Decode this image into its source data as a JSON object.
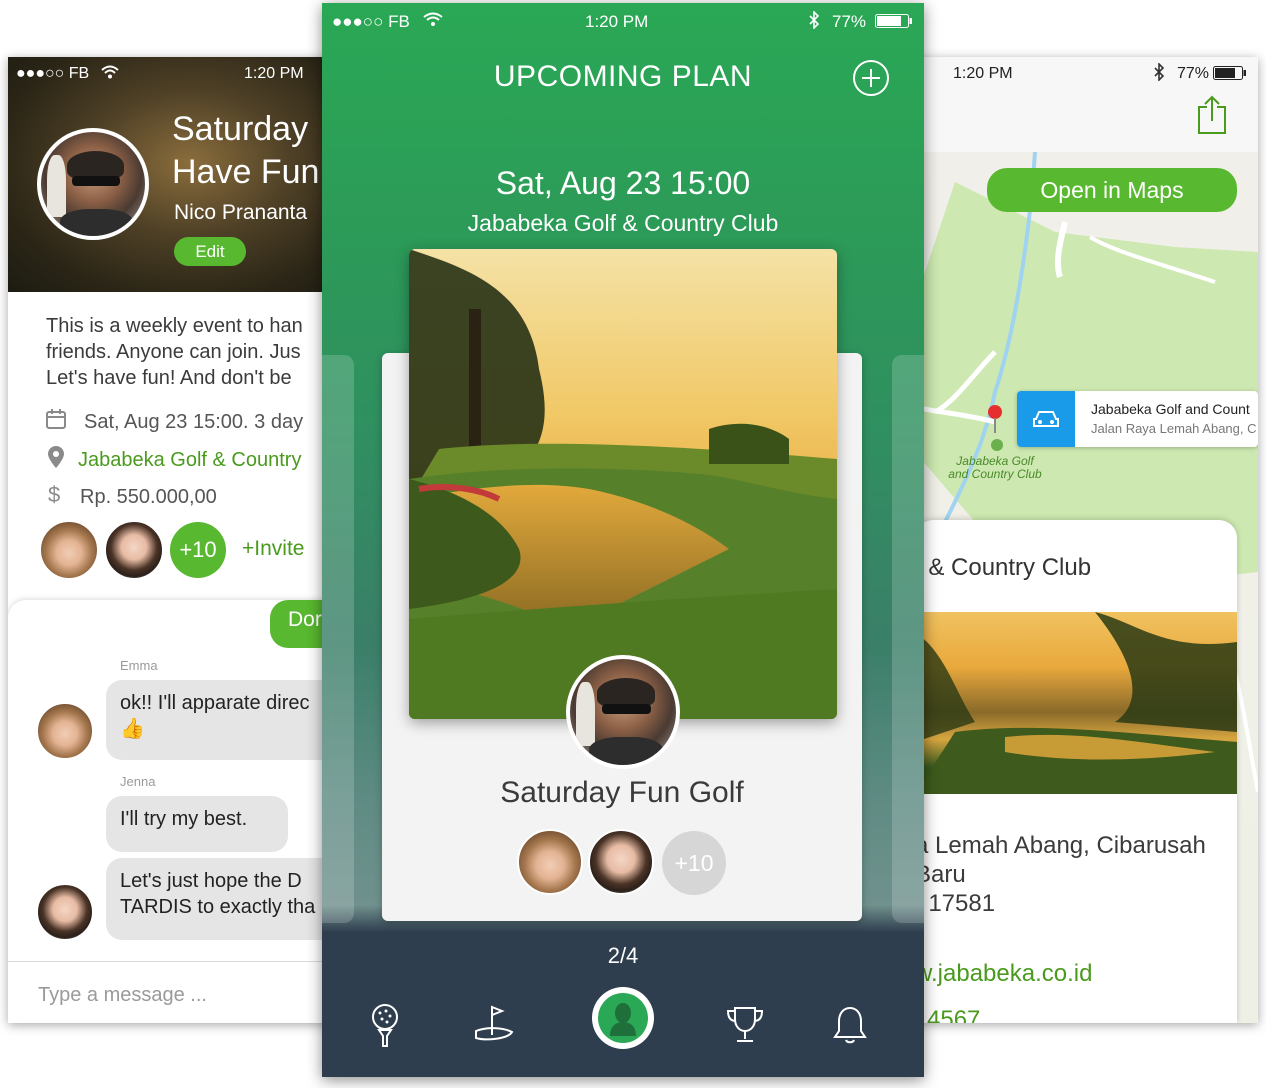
{
  "left_screen": {
    "status": {
      "carrier": "●●●○○ FB",
      "time": "1:20 PM"
    },
    "event_title_line1": "Saturday",
    "event_title_line2": "Have Fun",
    "host_name": "Nico Prananta",
    "edit_label": "Edit",
    "description_lines": [
      "This is a weekly event to han",
      "friends. Anyone can join. Jus",
      "Let's have fun! And don't be"
    ],
    "date_text": "Sat, Aug 23 15:00. 3 day",
    "location_text": "Jababeka Golf & Country",
    "price_text": "Rp. 550.000,00",
    "more_count": "+10",
    "invite_label": "+Invite",
    "chat": {
      "outgoing_partial": "Dor",
      "messages": [
        {
          "name": "Emma",
          "text": "ok!! I'll apparate direc",
          "emoji": "👍"
        },
        {
          "name": "Jenna",
          "text": "I'll try my best."
        },
        {
          "name": "",
          "line1": "Let's just hope the D",
          "line2": "TARDIS to exactly tha"
        }
      ],
      "input_placeholder": "Type a message ..."
    }
  },
  "center_screen": {
    "status": {
      "carrier": "●●●○○ FB",
      "time": "1:20 PM",
      "battery": "77%"
    },
    "header_title": "UPCOMING PLAN",
    "date_time": "Sat, Aug 23 15:00",
    "venue": "Jababeka Golf & Country Club",
    "event_name": "Saturday Fun Golf",
    "more_count": "+10",
    "pager": "2/4",
    "tabs": [
      "golf-ball",
      "golf-course",
      "profile",
      "trophy",
      "notifications"
    ],
    "accent_color": "#2aa855",
    "tabbar_color": "#2f3e4f"
  },
  "right_screen": {
    "status": {
      "time": "1:20 PM",
      "battery": "77%"
    },
    "open_maps_label": "Open in Maps",
    "callout_title": "Jababeka Golf and Count",
    "callout_subtitle": "Jalan Raya Lemah Abang, C",
    "map_label_line1": "Jababeka Golf",
    "map_label_line2": "and Country Club",
    "card_title": "f & Country Club",
    "address_line1": "a Lemah Abang, Cibarusah",
    "address_line2": "Baru",
    "address_line3": "t 17581",
    "website": "w.jababeka.co.id",
    "phone_partial": "4567"
  }
}
